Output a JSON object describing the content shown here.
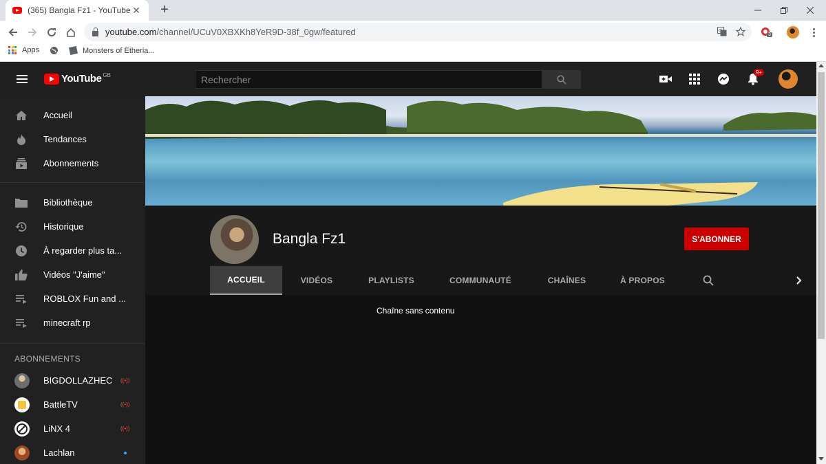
{
  "browser": {
    "tab_title": "(365) Bangla Fz1 - YouTube",
    "tab_close": "✕",
    "new_tab": "+",
    "url_host": "youtube.com",
    "url_path": "/channel/UCuV0XBXKh8YeR9D-38f_0gw/featured",
    "extension_badge": "3",
    "bookmarks": [
      {
        "label": "Apps",
        "icon": "apps-grid-icon"
      },
      {
        "label": "",
        "icon": "globe-icon"
      },
      {
        "label": "Monsters of Etheria...",
        "icon": "page-icon"
      }
    ]
  },
  "youtube": {
    "logo_text": "YouTube",
    "country": "GB",
    "search_placeholder": "Rechercher",
    "notification_count": "9+",
    "sidebar": {
      "main": [
        {
          "label": "Accueil",
          "icon": "home-icon"
        },
        {
          "label": "Tendances",
          "icon": "trending-flame-icon"
        },
        {
          "label": "Abonnements",
          "icon": "subscriptions-icon"
        }
      ],
      "library": [
        {
          "label": "Bibliothèque",
          "icon": "folder-icon"
        },
        {
          "label": "Historique",
          "icon": "history-icon"
        },
        {
          "label": "À regarder plus ta...",
          "icon": "clock-icon"
        },
        {
          "label": "Vidéos \"J'aime\"",
          "icon": "thumbs-up-icon"
        },
        {
          "label": "ROBLOX Fun and ...",
          "icon": "playlist-icon"
        },
        {
          "label": "minecraft rp",
          "icon": "playlist-icon"
        }
      ],
      "subscriptions_heading": "ABONNEMENTS",
      "subscriptions": [
        {
          "label": "BIGDOLLAZHEC",
          "status": "live",
          "color": "#8a8a8a"
        },
        {
          "label": "BattleTV",
          "status": "live",
          "color": "#f5c542"
        },
        {
          "label": "LiNX 4",
          "status": "live",
          "color": "#ffffff"
        },
        {
          "label": "Lachlan",
          "status": "new",
          "color": "#c06a3a"
        }
      ],
      "live_symbol": "((•))"
    },
    "channel": {
      "name": "Bangla Fz1",
      "subscribe_label": "S'ABONNER",
      "tabs": [
        "ACCUEIL",
        "VIDÉOS",
        "PLAYLISTS",
        "COMMUNAUTÉ",
        "CHAÎNES",
        "À PROPOS"
      ],
      "active_tab": "ACCUEIL",
      "empty_message": "Chaîne sans contenu"
    },
    "colors": {
      "subscribe_red": "#cc0000",
      "brand_red": "#ff0000",
      "bg": "#181818"
    }
  }
}
